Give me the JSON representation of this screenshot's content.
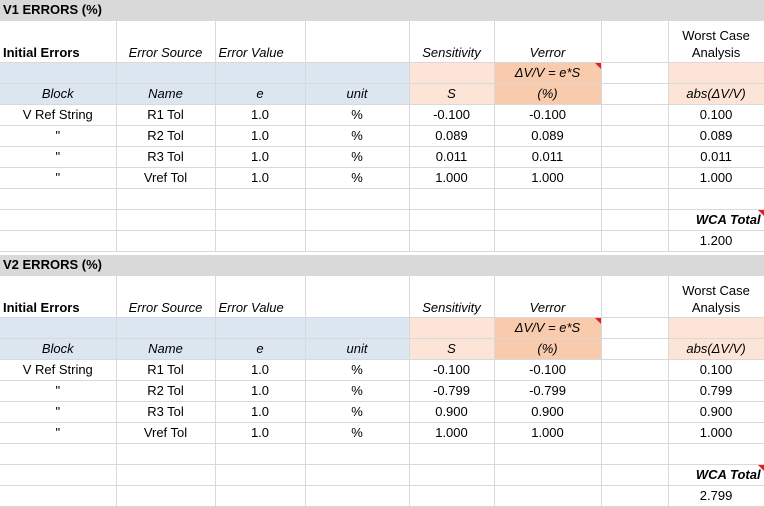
{
  "sections": [
    {
      "title": "V1 ERRORS (%)",
      "headers": {
        "initial_errors": "Initial Errors",
        "error_source": "Error Source",
        "error_value": "Error Value",
        "sensitivity": "Sensitivity",
        "verror": "Verror",
        "worst_case_line1": "Worst Case",
        "worst_case_line2": "Analysis",
        "block": "Block",
        "name": "Name",
        "e": "e",
        "unit": "unit",
        "s": "S",
        "formula": "ΔV/V  = e*S",
        "pct": "(%)",
        "abs": "abs(ΔV/V)"
      },
      "rows": [
        {
          "block": "V Ref String",
          "name": "R1 Tol",
          "e": "1.0",
          "unit": "%",
          "s": "-0.100",
          "verror": "-0.100",
          "abs": "0.100"
        },
        {
          "block": "\"",
          "name": "R2 Tol",
          "e": "1.0",
          "unit": "%",
          "s": "0.089",
          "verror": "0.089",
          "abs": "0.089"
        },
        {
          "block": "\"",
          "name": "R3 Tol",
          "e": "1.0",
          "unit": "%",
          "s": "0.011",
          "verror": "0.011",
          "abs": "0.011"
        },
        {
          "block": "\"",
          "name": "Vref Tol",
          "e": "1.0",
          "unit": "%",
          "s": "1.000",
          "verror": "1.000",
          "abs": "1.000"
        }
      ],
      "wca_label": "WCA Total",
      "wca_total": "1.200"
    },
    {
      "title": "V2 ERRORS (%)",
      "headers": {
        "initial_errors": "Initial Errors",
        "error_source": "Error Source",
        "error_value": "Error Value",
        "sensitivity": "Sensitivity",
        "verror": "Verror",
        "worst_case_line1": "Worst Case",
        "worst_case_line2": "Analysis",
        "block": "Block",
        "name": "Name",
        "e": "e",
        "unit": "unit",
        "s": "S",
        "formula": "ΔV/V  = e*S",
        "pct": "(%)",
        "abs": "abs(ΔV/V)"
      },
      "rows": [
        {
          "block": "V Ref String",
          "name": "R1 Tol",
          "e": "1.0",
          "unit": "%",
          "s": "-0.100",
          "verror": "-0.100",
          "abs": "0.100"
        },
        {
          "block": "\"",
          "name": "R2 Tol",
          "e": "1.0",
          "unit": "%",
          "s": "-0.799",
          "verror": "-0.799",
          "abs": "0.799"
        },
        {
          "block": "\"",
          "name": "R3 Tol",
          "e": "1.0",
          "unit": "%",
          "s": "0.900",
          "verror": "0.900",
          "abs": "0.900"
        },
        {
          "block": "\"",
          "name": "Vref Tol",
          "e": "1.0",
          "unit": "%",
          "s": "1.000",
          "verror": "1.000",
          "abs": "1.000"
        }
      ],
      "wca_label": "WCA Total",
      "wca_total": "2.799"
    }
  ],
  "colors": {
    "title_bar": "#d9d9d9",
    "header_blue": "#dce6f1",
    "sensitivity_peach": "#fce4d6",
    "verror_orange": "#f8cbad",
    "comment_marker": "#e02020"
  }
}
